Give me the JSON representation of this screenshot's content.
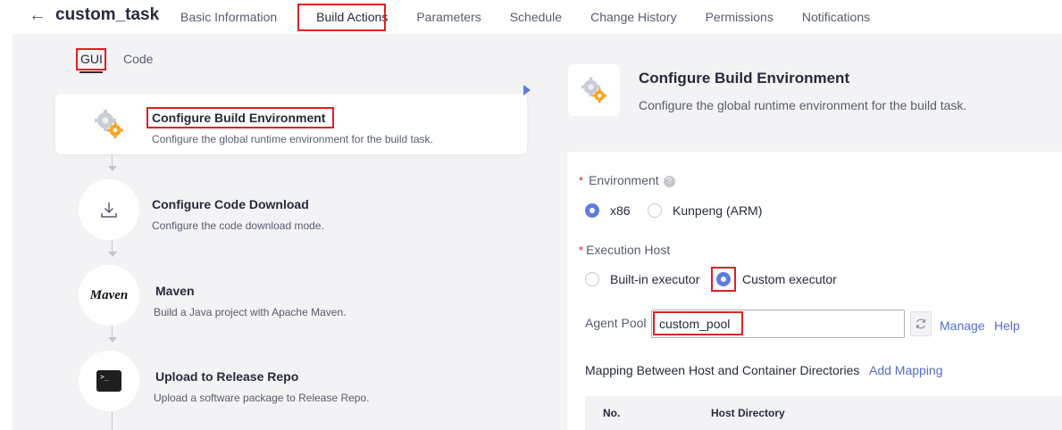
{
  "header": {
    "task_name": "custom_task",
    "tabs": [
      {
        "label": "Basic Information"
      },
      {
        "label": "Build Actions"
      },
      {
        "label": "Parameters"
      },
      {
        "label": "Schedule"
      },
      {
        "label": "Change History"
      },
      {
        "label": "Permissions"
      },
      {
        "label": "Notifications"
      }
    ],
    "active_tab": "Build Actions"
  },
  "mode_switch": {
    "gui_label": "GUI",
    "code_label": "Code",
    "active": "GUI"
  },
  "steps": [
    {
      "title": "Configure Build Environment",
      "description": "Configure the global runtime environment for the build task.",
      "icon": "gear-icon",
      "selected": true
    },
    {
      "title": "Configure Code Download",
      "description": "Configure the code download mode.",
      "icon": "download-icon"
    },
    {
      "title": "Maven",
      "description": "Build a Java project with Apache Maven.",
      "icon": "maven-logo",
      "logo_text": "Maven"
    },
    {
      "title": "Upload to Release Repo",
      "description": "Upload a software package to Release Repo.",
      "icon": "terminal-icon"
    }
  ],
  "detail": {
    "title": "Configure Build Environment",
    "description": "Configure the global runtime environment for the build task.",
    "environment": {
      "label": "Environment",
      "options": [
        "x86",
        "Kunpeng (ARM)"
      ],
      "selected": "x86"
    },
    "execution_host": {
      "label": "Execution Host",
      "options": [
        "Built-in executor",
        "Custom executor"
      ],
      "selected": "Custom executor"
    },
    "agent_pool": {
      "label": "Agent Pool",
      "value": "custom_pool",
      "manage_label": "Manage",
      "help_label": "Help"
    },
    "mapping": {
      "label": "Mapping Between Host and Container Directories",
      "add_label": "Add Mapping",
      "columns": [
        "No.",
        "Host Directory"
      ]
    }
  },
  "colors": {
    "accent": "#5e7ce0",
    "link": "#526ecc",
    "highlight": "#e02020",
    "panel_bg": "#f3f3f5"
  }
}
